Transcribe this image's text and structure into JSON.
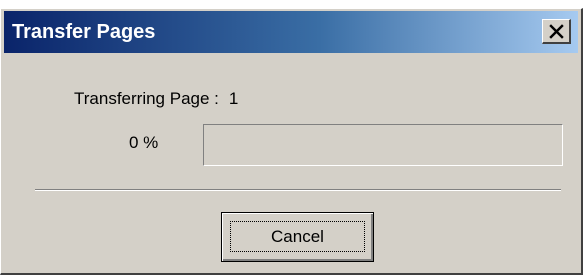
{
  "dialog": {
    "title": "Transfer Pages",
    "close_icon": "close-icon",
    "transferring_label": "Transferring Page :",
    "page_number": "1",
    "percent_text": "0 %",
    "progress_fraction": 0,
    "cancel_label": "Cancel"
  },
  "colors": {
    "title_bar_start": "#0a246a",
    "title_bar_end": "#a6caf0",
    "dialog_face": "#d4d0c8"
  }
}
